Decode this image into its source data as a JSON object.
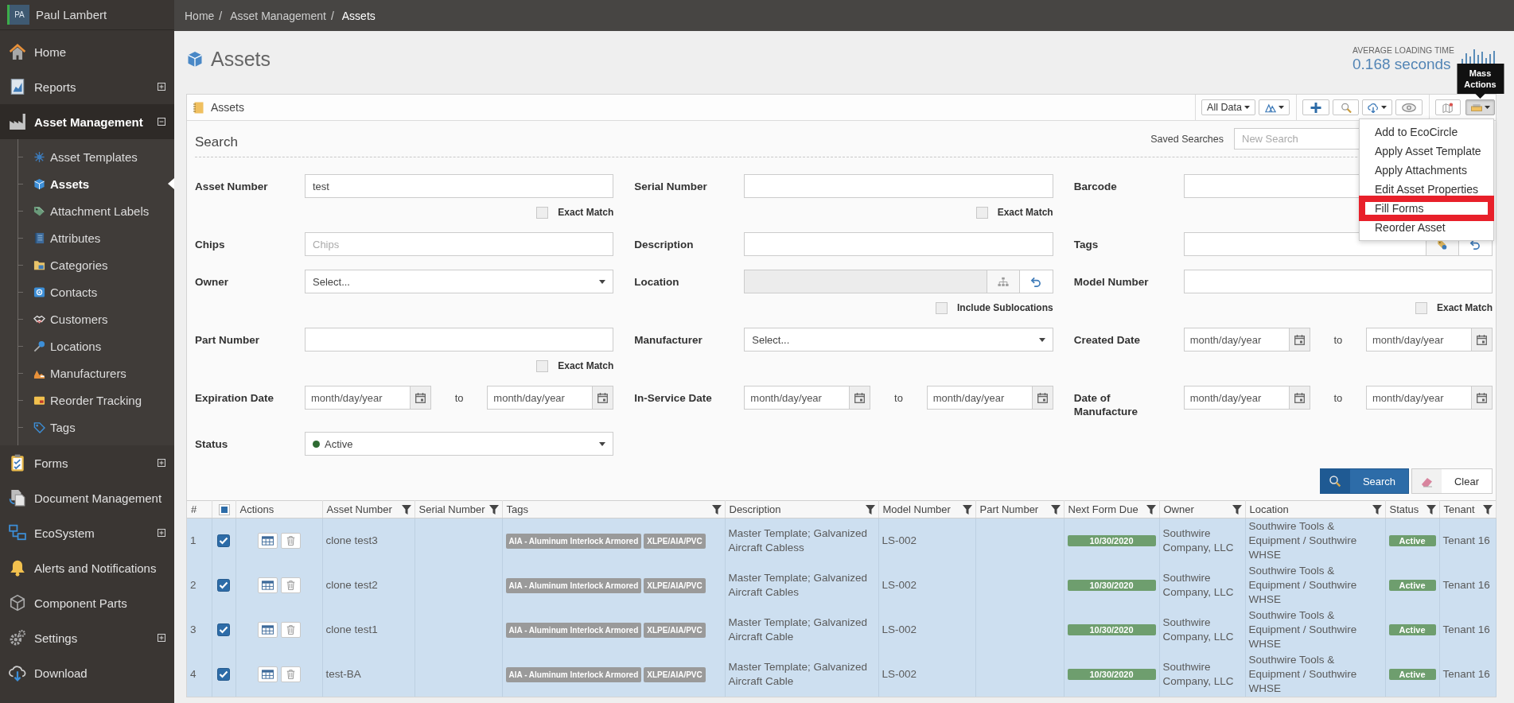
{
  "sidebar": {
    "user": {
      "initials": "PA",
      "name": "Paul Lambert"
    },
    "items": [
      {
        "label": "Home",
        "kind": "link"
      },
      {
        "label": "Reports",
        "kind": "group",
        "expanded": false
      },
      {
        "label": "Asset Management",
        "kind": "group",
        "expanded": true,
        "children": [
          {
            "label": "Asset Templates",
            "selected": false
          },
          {
            "label": "Assets",
            "selected": true
          },
          {
            "label": "Attachment Labels",
            "selected": false
          },
          {
            "label": "Attributes",
            "selected": false
          },
          {
            "label": "Categories",
            "selected": false
          },
          {
            "label": "Contacts",
            "selected": false
          },
          {
            "label": "Customers",
            "selected": false
          },
          {
            "label": "Locations",
            "selected": false
          },
          {
            "label": "Manufacturers",
            "selected": false
          },
          {
            "label": "Reorder Tracking",
            "selected": false
          },
          {
            "label": "Tags",
            "selected": false
          }
        ]
      },
      {
        "label": "Forms",
        "kind": "group",
        "expanded": false
      },
      {
        "label": "Document Management",
        "kind": "link"
      },
      {
        "label": "EcoSystem",
        "kind": "group",
        "expanded": false
      },
      {
        "label": "Alerts and Notifications",
        "kind": "link"
      },
      {
        "label": "Component Parts",
        "kind": "link"
      },
      {
        "label": "Settings",
        "kind": "group",
        "expanded": false
      },
      {
        "label": "Download",
        "kind": "link"
      }
    ]
  },
  "breadcrumbs": [
    {
      "label": "Home",
      "separator": "/",
      "current": false
    },
    {
      "label": "Asset Management",
      "separator": "/",
      "current": false
    },
    {
      "label": "Assets",
      "current": true
    }
  ],
  "page": {
    "title": "Assets",
    "loading_time": {
      "label": "AVERAGE LOADING TIME",
      "value": "0.168 seconds"
    }
  },
  "panel": {
    "title": "Assets",
    "toolbar": {
      "scope": "All Data",
      "mass_actions": {
        "tooltip": "Mass Actions",
        "open": true,
        "items": [
          {
            "label": "Add to EcoCircle",
            "highlighted": false
          },
          {
            "label": "Apply Asset Template",
            "highlighted": false
          },
          {
            "label": "Apply Attachments",
            "highlighted": false
          },
          {
            "label": "Edit Asset Properties",
            "highlighted": false
          },
          {
            "label": "Fill Forms",
            "highlighted": true
          },
          {
            "label": "Reorder Asset",
            "highlighted": false
          }
        ]
      }
    }
  },
  "search": {
    "title": "Search",
    "saved_searches": {
      "label": "Saved Searches",
      "placeholder": "New Search"
    },
    "fields": [
      {
        "label": "Asset Number",
        "kind": "text",
        "value": "test",
        "option": {
          "label": "Exact Match",
          "checked": false
        }
      },
      {
        "label": "Serial Number",
        "kind": "text",
        "option": {
          "label": "Exact Match",
          "checked": false
        }
      },
      {
        "label": "Barcode",
        "kind": "text"
      },
      {
        "label": "Chips",
        "kind": "text",
        "placeholder": "Chips"
      },
      {
        "label": "Description",
        "kind": "text"
      },
      {
        "label": "Tags",
        "kind": "tag_picker",
        "disabled": false
      },
      {
        "label": "Owner",
        "kind": "select",
        "value": "Select..."
      },
      {
        "label": "Location",
        "kind": "location_picker",
        "disabled": true,
        "option": {
          "label": "Include Sublocations",
          "checked": false
        }
      },
      {
        "label": "Model Number",
        "kind": "text",
        "option": {
          "label": "Exact Match",
          "checked": false
        }
      },
      {
        "label": "Part Number",
        "kind": "text",
        "option": {
          "label": "Exact Match",
          "checked": false
        }
      },
      {
        "label": "Manufacturer",
        "kind": "select",
        "value": "Select..."
      },
      {
        "label": "Created Date",
        "kind": "date_range",
        "from": {
          "placeholder": "month/day/year"
        },
        "separator": "to",
        "to": {
          "placeholder": "month/day/year"
        }
      },
      {
        "label": "Expiration Date",
        "kind": "date_range",
        "from": {
          "placeholder": "month/day/year"
        },
        "separator": "to",
        "to": {
          "placeholder": "month/day/year"
        }
      },
      {
        "label": "In-Service Date",
        "kind": "date_range",
        "from": {
          "placeholder": "month/day/year"
        },
        "separator": "to",
        "to": {
          "placeholder": "month/day/year"
        }
      },
      {
        "label": "Date of Manufacture",
        "kind": "date_range",
        "from": {
          "placeholder": "month/day/year"
        },
        "separator": "to",
        "to": {
          "placeholder": "month/day/year"
        }
      },
      {
        "label": "Status",
        "kind": "select",
        "value": "Active",
        "color": "#2e6b32"
      }
    ],
    "buttons": [
      {
        "label": "Search",
        "kind": "primary"
      },
      {
        "label": "Clear",
        "kind": "reset"
      }
    ]
  },
  "table": {
    "columns": [
      {
        "label": "#",
        "filter": false
      },
      {
        "kind": "select",
        "indeterminate": true
      },
      {
        "label": "Actions",
        "filter": false
      },
      {
        "label": "Asset Number",
        "filter": true
      },
      {
        "label": "Serial Number",
        "filter": true
      },
      {
        "label": "Tags",
        "filter": true
      },
      {
        "label": "Description",
        "filter": true
      },
      {
        "label": "Model Number",
        "filter": true
      },
      {
        "label": "Part Number",
        "filter": true
      },
      {
        "label": "Next Form Due",
        "filter": true
      },
      {
        "label": "Owner",
        "filter": true
      },
      {
        "label": "Location",
        "filter": true
      },
      {
        "label": "Status",
        "filter": true
      },
      {
        "label": "Tenant",
        "filter": true
      }
    ],
    "rows": [
      {
        "number": "1",
        "selected": true,
        "asset_number": "clone test3",
        "tags": [
          "AIA - Aluminum Interlock Armored",
          "XLPE/AIA/PVC"
        ],
        "description": "Master Template; Galvanized Aircraft Cabless",
        "model_number": "LS-002",
        "next_form_due": "10/30/2020",
        "owner": "Southwire Company, LLC",
        "location": "Southwire Tools & Equipment / Southwire WHSE",
        "status": "Active",
        "tenant": "Tenant 16"
      },
      {
        "number": "2",
        "selected": true,
        "asset_number": "clone test2",
        "tags": [
          "AIA - Aluminum Interlock Armored",
          "XLPE/AIA/PVC"
        ],
        "description": "Master Template; Galvanized Aircraft Cables",
        "model_number": "LS-002",
        "next_form_due": "10/30/2020",
        "owner": "Southwire Company, LLC",
        "location": "Southwire Tools & Equipment / Southwire WHSE",
        "status": "Active",
        "tenant": "Tenant 16"
      },
      {
        "number": "3",
        "selected": true,
        "asset_number": "clone test1",
        "tags": [
          "AIA - Aluminum Interlock Armored",
          "XLPE/AIA/PVC"
        ],
        "description": "Master Template; Galvanized Aircraft Cable",
        "model_number": "LS-002",
        "next_form_due": "10/30/2020",
        "owner": "Southwire Company, LLC",
        "location": "Southwire Tools & Equipment / Southwire WHSE",
        "status": "Active",
        "tenant": "Tenant 16"
      },
      {
        "number": "4",
        "selected": true,
        "asset_number": "test-BA",
        "tags": [
          "AIA - Aluminum Interlock Armored",
          "XLPE/AIA/PVC"
        ],
        "description": "Master Template; Galvanized Aircraft Cable",
        "model_number": "LS-002",
        "next_form_due": "10/30/2020",
        "owner": "Southwire Company, LLC",
        "location": "Southwire Tools & Equipment / Southwire WHSE",
        "status": "Active",
        "tenant": "Tenant 16"
      }
    ]
  }
}
